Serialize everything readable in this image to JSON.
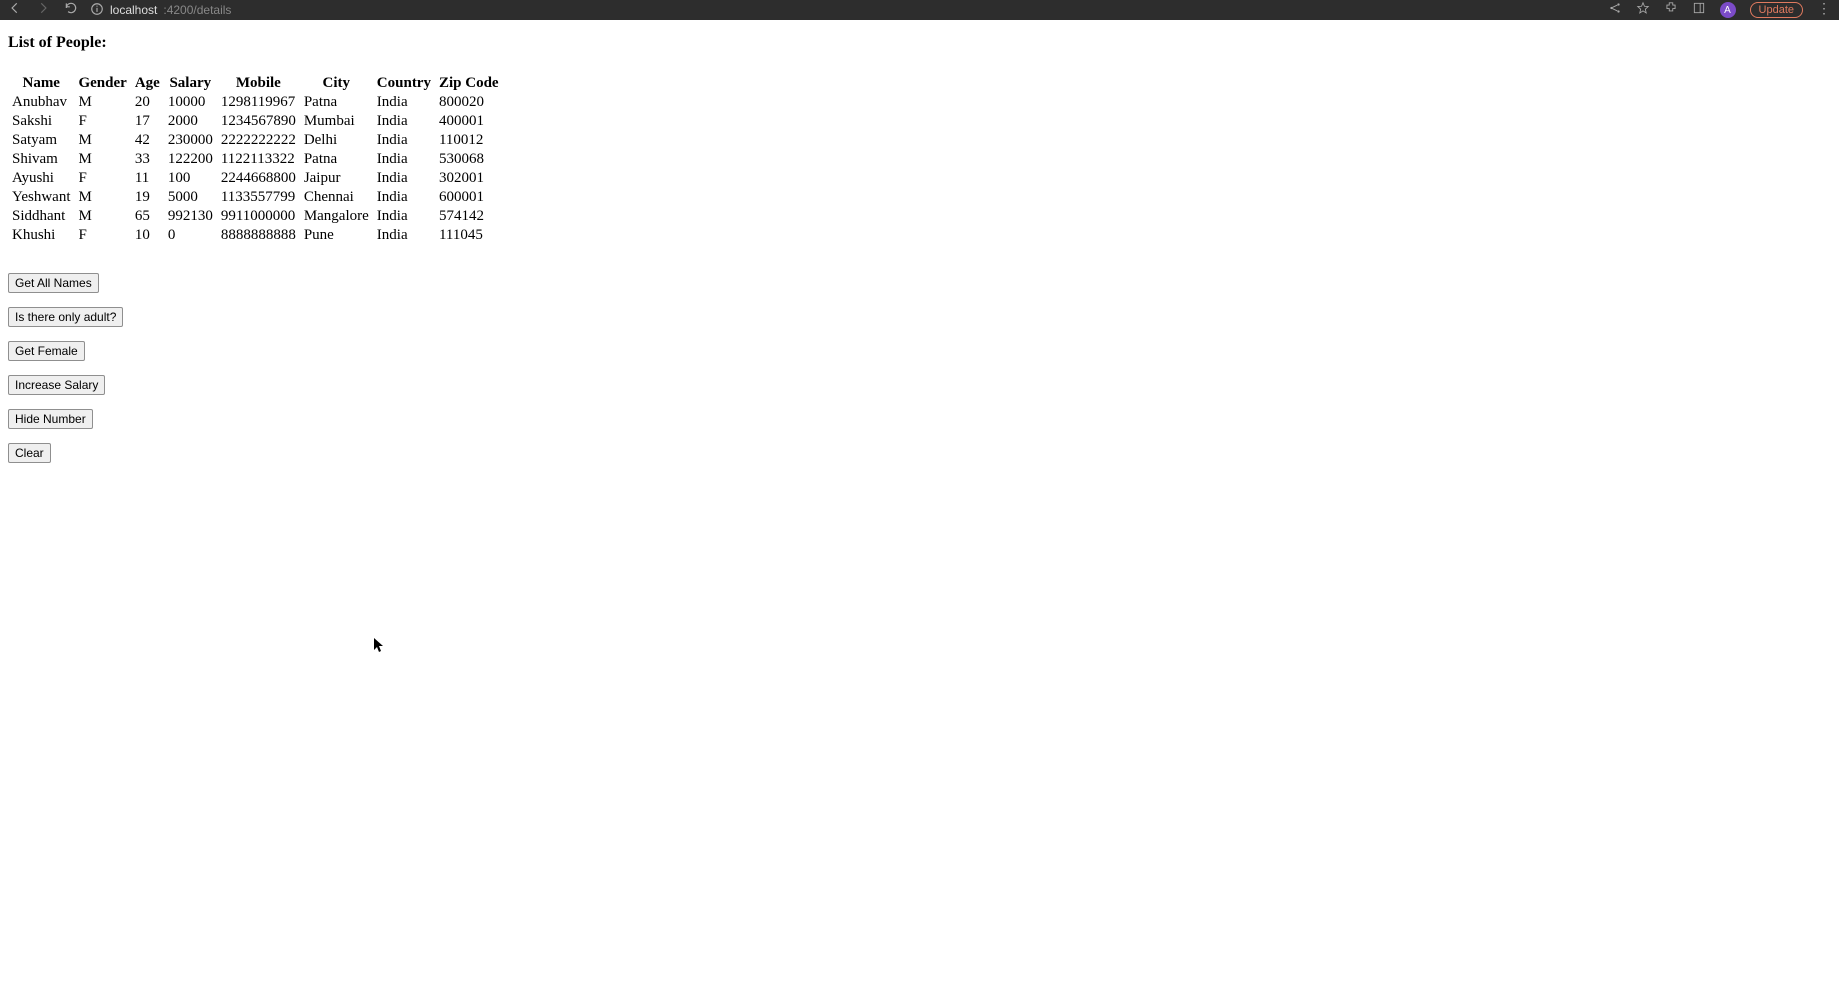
{
  "browser": {
    "url_host": "localhost",
    "url_port_path": ":4200/details",
    "avatar_letter": "A",
    "update_label": "Update"
  },
  "page": {
    "title": "List of People:"
  },
  "table": {
    "headers": [
      "Name",
      "Gender",
      "Age",
      "Salary",
      "Mobile",
      "City",
      "Country",
      "Zip Code"
    ],
    "rows": [
      {
        "name": "Anubhav",
        "gender": "M",
        "age": "20",
        "salary": "10000",
        "mobile": "1298119967",
        "city": "Patna",
        "country": "India",
        "zip": "800020"
      },
      {
        "name": "Sakshi",
        "gender": "F",
        "age": "17",
        "salary": "2000",
        "mobile": "1234567890",
        "city": "Mumbai",
        "country": "India",
        "zip": "400001"
      },
      {
        "name": "Satyam",
        "gender": "M",
        "age": "42",
        "salary": "230000",
        "mobile": "2222222222",
        "city": "Delhi",
        "country": "India",
        "zip": "110012"
      },
      {
        "name": "Shivam",
        "gender": "M",
        "age": "33",
        "salary": "122200",
        "mobile": "1122113322",
        "city": "Patna",
        "country": "India",
        "zip": "530068"
      },
      {
        "name": "Ayushi",
        "gender": "F",
        "age": "11",
        "salary": "100",
        "mobile": "2244668800",
        "city": "Jaipur",
        "country": "India",
        "zip": "302001"
      },
      {
        "name": "Yeshwant",
        "gender": "M",
        "age": "19",
        "salary": "5000",
        "mobile": "1133557799",
        "city": "Chennai",
        "country": "India",
        "zip": "600001"
      },
      {
        "name": "Siddhant",
        "gender": "M",
        "age": "65",
        "salary": "992130",
        "mobile": "9911000000",
        "city": "Mangalore",
        "country": "India",
        "zip": "574142"
      },
      {
        "name": "Khushi",
        "gender": "F",
        "age": "10",
        "salary": "0",
        "mobile": "8888888888",
        "city": "Pune",
        "country": "India",
        "zip": "111045"
      }
    ]
  },
  "buttons": {
    "get_all_names": "Get All Names",
    "is_only_adult": "Is there only adult?",
    "get_female": "Get Female",
    "increase_salary": "Increase Salary",
    "hide_number": "Hide Number",
    "clear": "Clear"
  }
}
